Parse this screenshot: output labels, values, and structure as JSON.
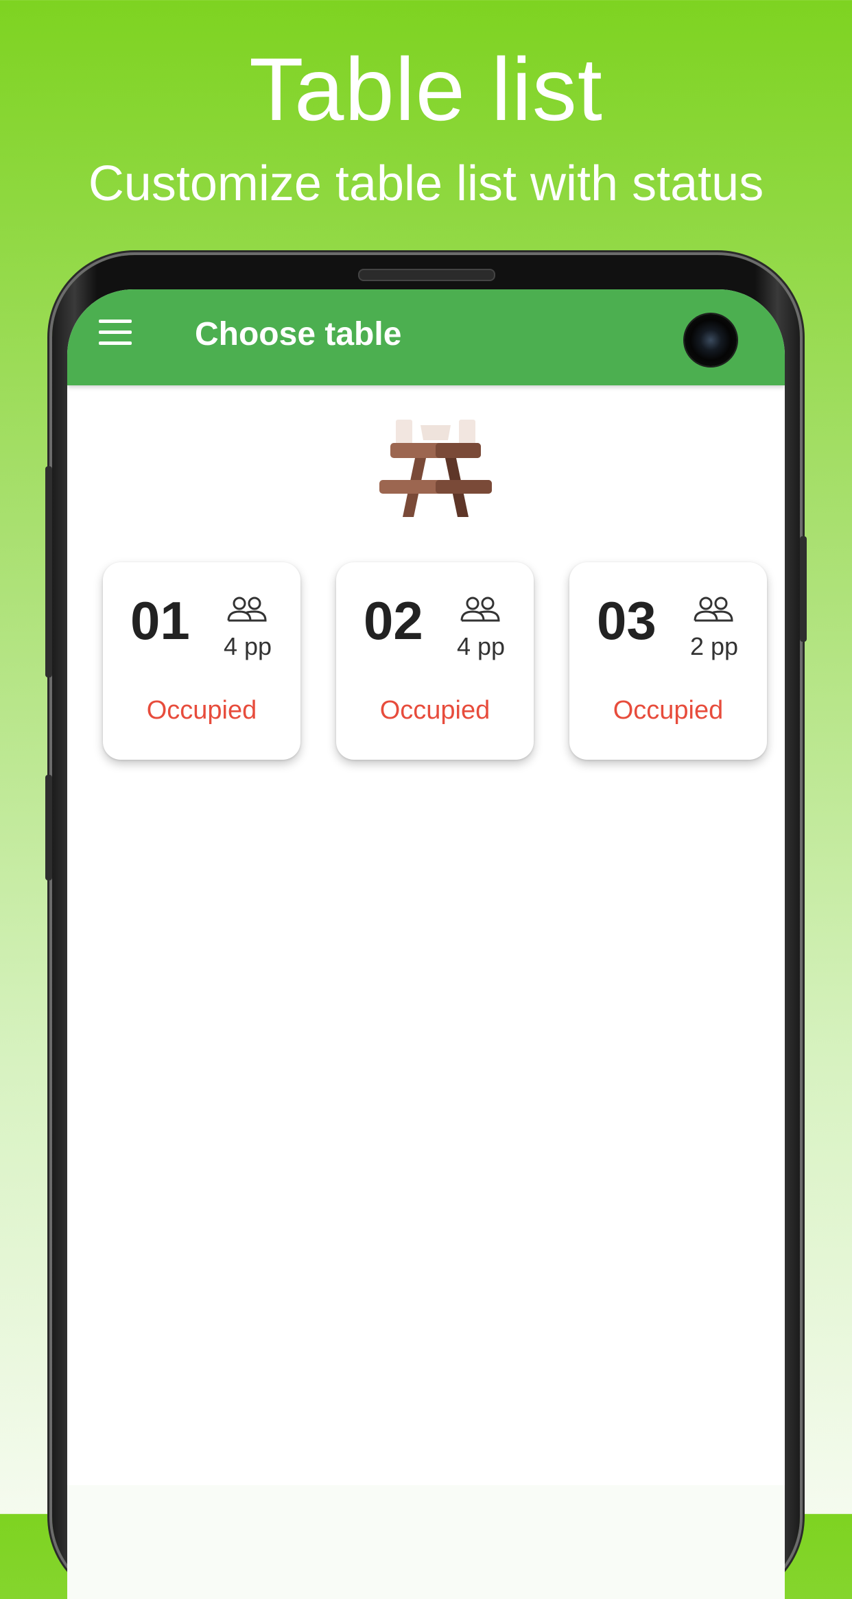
{
  "promo": {
    "title": "Table list",
    "subtitle": "Customize table list with status"
  },
  "app_bar": {
    "title": "Choose table",
    "menu_icon": "hamburger-menu-icon",
    "color": "#4caf50"
  },
  "hero": {
    "icon": "picnic-table-icon"
  },
  "tables": [
    {
      "number": "01",
      "capacity": "4 pp",
      "status": "Occupied"
    },
    {
      "number": "02",
      "capacity": "4 pp",
      "status": "Occupied"
    },
    {
      "number": "03",
      "capacity": "2 pp",
      "status": "Occupied"
    }
  ],
  "colors": {
    "status_occupied": "#e74c3c",
    "background_top": "#7ed321",
    "table_wood": "#8d5a44"
  }
}
